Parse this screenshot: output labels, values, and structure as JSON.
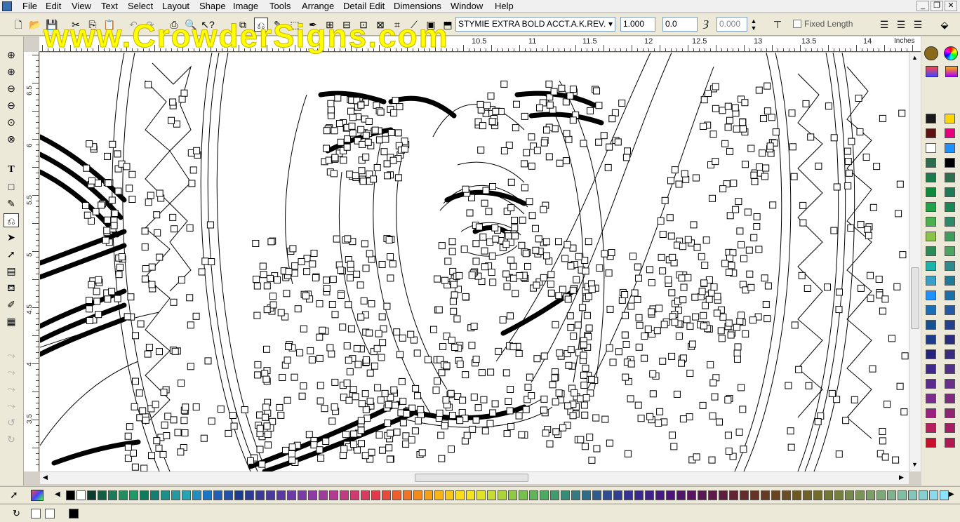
{
  "menu": {
    "items": [
      "File",
      "Edit",
      "View",
      "Text",
      "Select",
      "Layout",
      "Shape",
      "Image",
      "Tools",
      "Arrange",
      "Detail Edit",
      "Dimensions",
      "Window",
      "Help"
    ]
  },
  "window_controls": {
    "minimize": "_",
    "restore": "❐",
    "close": "✕"
  },
  "toolbar": {
    "font_name": "STYMIE EXTRA BOLD ACCT.A.K.REV.",
    "font_size": "1.000",
    "spacing": "0.0",
    "slant": "0.000",
    "fixed_length_label": "Fixed Length"
  },
  "watermark": "www.CrowderSigns.com",
  "ruler": {
    "units": "Inches",
    "top_labels": [
      "10.5",
      "11",
      "11.5",
      "12",
      "12.5",
      "13",
      "13.5",
      "14"
    ],
    "left_labels": [
      "6.5",
      "6",
      "5.5",
      "5",
      "4.5",
      "4",
      "3.5"
    ]
  },
  "icons": {
    "left_tools": [
      "zoom-in-icon",
      "zoom-area-icon",
      "zoom-out-icon",
      "zoom-previous-icon",
      "zoom-fit-icon",
      "zoom-all-icon",
      "text-tool-icon",
      "rectangle-tool-icon",
      "pencil-tool-icon",
      "node-edit-icon",
      "select-arrow-icon",
      "node-select-icon",
      "measure-tool-icon",
      "fill-bucket-icon",
      "eyedropper-icon",
      "grid-icon"
    ],
    "top_tools": [
      "new-file-icon",
      "open-folder-icon",
      "save-icon",
      "cut-icon",
      "copy-icon",
      "paste-icon",
      "undo-icon",
      "redo-icon",
      "print-icon",
      "find-icon",
      "help-pointer-icon"
    ]
  },
  "colors": {
    "watermark": "#ffff00",
    "right_palette": [
      "#1a1a1a",
      "#5a1414",
      "#ffffff",
      "#2e6b4e",
      "#1d7a4a",
      "#0f8a3d",
      "#22a04a",
      "#4caf50",
      "#8bc34a",
      "#2e8b57",
      "#20b2aa",
      "#3aa0c8",
      "#1e90ff",
      "#1b6fb5",
      "#16508f",
      "#1c3c8c",
      "#26237a",
      "#3f2a8c",
      "#5b2b8f",
      "#7b2d8e",
      "#9c2080",
      "#b81f5f",
      "#c8102e"
    ],
    "right_palette2": [
      "#ffd700",
      "#e6007e",
      "#1e90ff",
      "#000000",
      "#2f6f4f",
      "#1e7b57",
      "#198754",
      "#2c8a68",
      "#3c9d5c",
      "#4aa561",
      "#2e8b8b",
      "#1f7a9a",
      "#1a6fa8",
      "#2359a5",
      "#23418c",
      "#2b2e7e",
      "#392c80",
      "#523289",
      "#6b2f8c",
      "#7e2a7e",
      "#922573",
      "#a61e63",
      "#b31754"
    ],
    "bottom_palette": [
      "#000000",
      "#ffffff",
      "#0b3d2e",
      "#115e45",
      "#1b7a57",
      "#218c5f",
      "#1e9a68",
      "#0f7a5c",
      "#137e72",
      "#1d8f88",
      "#239aa0",
      "#27a3b3",
      "#1f8fc2",
      "#1976c4",
      "#1f5fb8",
      "#2450a8",
      "#1b3d8f",
      "#2d3c92",
      "#3b3a96",
      "#4a3a9c",
      "#5a3aa2",
      "#6a3aa6",
      "#7c3aa8",
      "#8e3aa6",
      "#a03a9e",
      "#b23a92",
      "#c23a82",
      "#cf3a70",
      "#da3a5e",
      "#e23a4c",
      "#e84a3a",
      "#ec5e2c",
      "#f07424",
      "#f48a1c",
      "#f6a016",
      "#f8b414",
      "#f9c814",
      "#fadc18",
      "#f4e41e",
      "#dfe226",
      "#c6dc30",
      "#abd43a",
      "#90ca44",
      "#76c04e",
      "#5fb658",
      "#4caa62",
      "#3f9c6c",
      "#368c76",
      "#327c80",
      "#306c88",
      "#2f5c8e",
      "#304c92",
      "#323e94",
      "#353294",
      "#3a2890",
      "#40208a",
      "#461a82",
      "#4c1678",
      "#52146c",
      "#571460",
      "#5b1654",
      "#5e1a48",
      "#601e3e",
      "#622434",
      "#642a2c",
      "#663226",
      "#683a22",
      "#6a4420",
      "#6c4e20",
      "#6e5822",
      "#706226",
      "#726c2c",
      "#747634",
      "#76803e",
      "#788a4a",
      "#7a9458",
      "#7c9e68",
      "#7ea87a",
      "#80b28e",
      "#82bca4",
      "#84c6bc",
      "#86d0d4",
      "#88daec",
      "#8ae4ff",
      "#f0c0d0"
    ]
  }
}
